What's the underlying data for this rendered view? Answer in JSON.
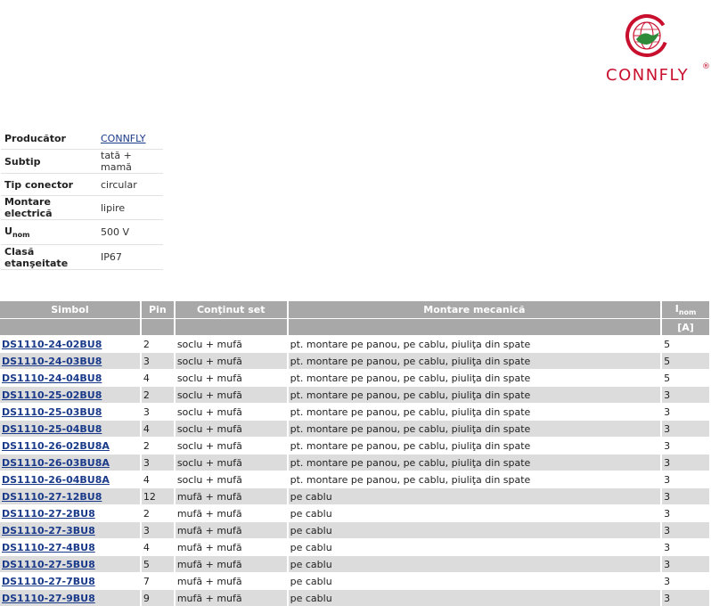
{
  "brand": {
    "name": "CONNFLY",
    "registered": "®",
    "colors": {
      "red": "#c8102e",
      "green": "#2e8b3a",
      "link": "#1a3a8a",
      "header_bg": "#a8a8a8",
      "row_alt": "#dcdcdc"
    }
  },
  "properties": [
    {
      "key": "Producător",
      "value": "CONNFLY",
      "is_link": true
    },
    {
      "key": "Subtip",
      "value": "tată + mamă"
    },
    {
      "key": "Tip conector",
      "value": "circular"
    },
    {
      "key": "Montare electrică",
      "value": "lipire"
    },
    {
      "key_main": "U",
      "key_sub": "nom",
      "value": "500 V"
    },
    {
      "key": "Clasă etanşeitate",
      "value": "IP67"
    }
  ],
  "table": {
    "headers": {
      "symbol": "Simbol",
      "pin": "Pin",
      "set": "Conţinut set",
      "mount": "Montare mecanică",
      "inom_main": "I",
      "inom_sub": "nom",
      "inom_unit": "[A]"
    },
    "rows": [
      {
        "symbol": "DS1110-24-02BU8",
        "pin": "2",
        "set": "soclu + mufă",
        "mount": "pt. montare pe panou, pe cablu, piuliţa din spate",
        "inom": "5"
      },
      {
        "symbol": "DS1110-24-03BU8",
        "pin": "3",
        "set": "soclu + mufă",
        "mount": "pt. montare pe panou, pe cablu, piuliţa din spate",
        "inom": "5"
      },
      {
        "symbol": "DS1110-24-04BU8",
        "pin": "4",
        "set": "soclu + mufă",
        "mount": "pt. montare pe panou, pe cablu, piuliţa din spate",
        "inom": "5"
      },
      {
        "symbol": "DS1110-25-02BU8",
        "pin": "2",
        "set": "soclu + mufă",
        "mount": "pt. montare pe panou, pe cablu, piuliţa din spate",
        "inom": "3"
      },
      {
        "symbol": "DS1110-25-03BU8",
        "pin": "3",
        "set": "soclu + mufă",
        "mount": "pt. montare pe panou, pe cablu, piuliţa din spate",
        "inom": "3"
      },
      {
        "symbol": "DS1110-25-04BU8",
        "pin": "4",
        "set": "soclu + mufă",
        "mount": "pt. montare pe panou, pe cablu, piuliţa din spate",
        "inom": "3"
      },
      {
        "symbol": "DS1110-26-02BU8A",
        "pin": "2",
        "set": "soclu + mufă",
        "mount": "pt. montare pe panou, pe cablu, piuliţa din spate",
        "inom": "3"
      },
      {
        "symbol": "DS1110-26-03BU8A",
        "pin": "3",
        "set": "soclu + mufă",
        "mount": "pt. montare pe panou, pe cablu, piuliţa din spate",
        "inom": "3"
      },
      {
        "symbol": "DS1110-26-04BU8A",
        "pin": "4",
        "set": "soclu + mufă",
        "mount": "pt. montare pe panou, pe cablu, piuliţa din spate",
        "inom": "3"
      },
      {
        "symbol": "DS1110-27-12BU8",
        "pin": "12",
        "set": "mufă + mufă",
        "mount": "pe cablu",
        "inom": "3"
      },
      {
        "symbol": "DS1110-27-2BU8",
        "pin": "2",
        "set": "mufă + mufă",
        "mount": "pe cablu",
        "inom": "3"
      },
      {
        "symbol": "DS1110-27-3BU8",
        "pin": "3",
        "set": "mufă + mufă",
        "mount": "pe cablu",
        "inom": "3"
      },
      {
        "symbol": "DS1110-27-4BU8",
        "pin": "4",
        "set": "mufă + mufă",
        "mount": "pe cablu",
        "inom": "3"
      },
      {
        "symbol": "DS1110-27-5BU8",
        "pin": "5",
        "set": "mufă + mufă",
        "mount": "pe cablu",
        "inom": "3"
      },
      {
        "symbol": "DS1110-27-7BU8",
        "pin": "7",
        "set": "mufă + mufă",
        "mount": "pe cablu",
        "inom": "3"
      },
      {
        "symbol": "DS1110-27-9BU8",
        "pin": "9",
        "set": "mufă + mufă",
        "mount": "pe cablu",
        "inom": "3"
      }
    ]
  }
}
